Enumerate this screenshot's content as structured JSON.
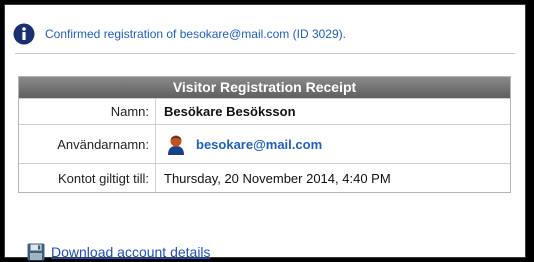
{
  "colors": {
    "background": "#000000",
    "panel": "#ffffff",
    "link": "#1f5fbf",
    "header_bar": "#6e6e6e"
  },
  "notice": {
    "icon": "info-icon",
    "text": "Confirmed registration of besokare@mail.com (ID 3029)."
  },
  "receipt": {
    "title": "Visitor Registration Receipt",
    "rows": [
      {
        "label": "Namn:",
        "value": "Besökare Besöksson"
      },
      {
        "label": "Användarnamn:",
        "value": "besokare@mail.com",
        "icon": "user-avatar-icon"
      },
      {
        "label": "Kontot giltigt till:",
        "value": "Thursday, 20 November 2014, 4:40 PM"
      }
    ]
  },
  "download": {
    "icon": "floppy-disk-icon",
    "label": "Download account details"
  }
}
